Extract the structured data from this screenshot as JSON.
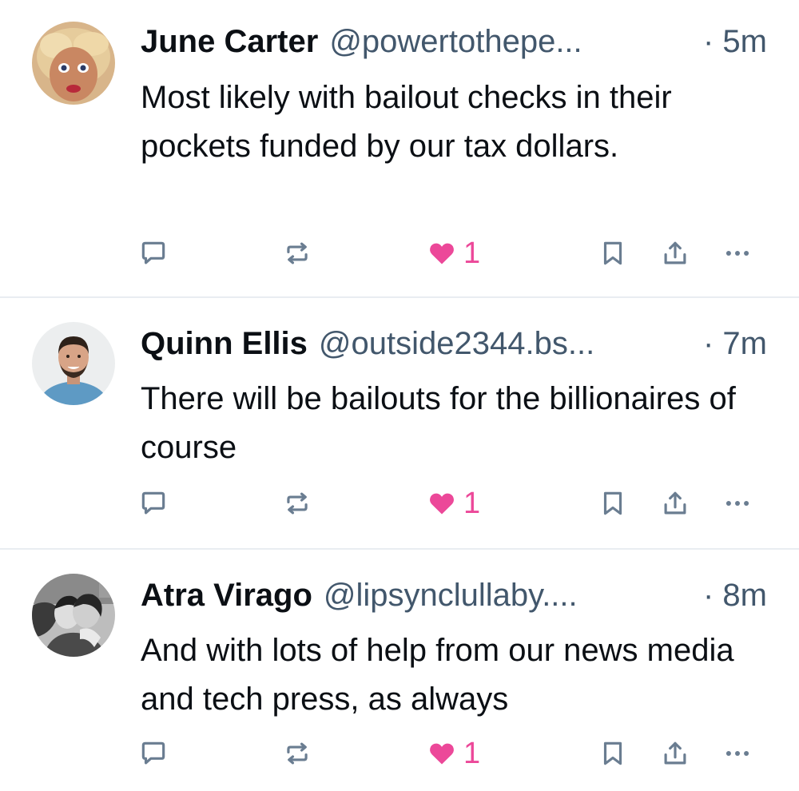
{
  "posts": [
    {
      "author": "June Carter",
      "handle": "@powertothepe...",
      "time": "· 5m",
      "text": "Most likely with bailout checks in their pockets funded by our tax dollars.",
      "likes": "1",
      "liked": true,
      "avatar": "doll-face-avatar"
    },
    {
      "author": "Quinn Ellis",
      "handle": "@outside2344.bs...",
      "time": "· 7m",
      "text": "There will be bailouts for the billionaires of course",
      "likes": "1",
      "liked": true,
      "avatar": "smiling-man-avatar"
    },
    {
      "author": "Atra Virago",
      "handle": "@lipsynclullaby....",
      "time": "· 8m",
      "text": "And with lots of help from our news media and tech press, as always",
      "likes": "1",
      "liked": true,
      "avatar": "black-white-photo-avatar"
    }
  ],
  "icons": {
    "reply": "reply-icon",
    "repost": "repost-icon",
    "like": "heart-icon",
    "bookmark": "bookmark-icon",
    "share": "share-icon",
    "more": "more-icon"
  },
  "colors": {
    "text": "#0b0f14",
    "secondary": "#42576c",
    "icon": "#6a7d91",
    "like": "#ec4899",
    "divider": "#e9edf1"
  }
}
